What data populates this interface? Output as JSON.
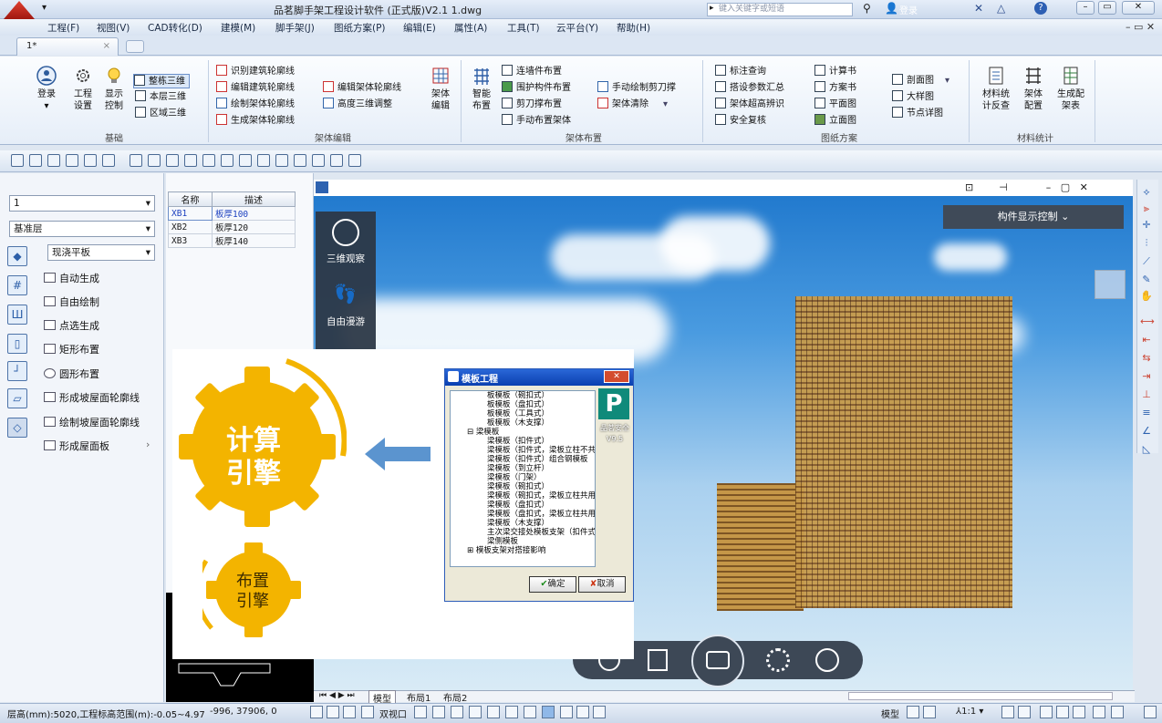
{
  "window": {
    "title": "品茗脚手架工程设计软件 (正式版)V2.1    1.dwg",
    "search_placeholder": "键入关键字或短语",
    "login": "登录",
    "controls": {
      "minimize": "–",
      "restore": "▭",
      "close": "✕"
    }
  },
  "menu": [
    "工程(F)",
    "视图(V)",
    "CAD转化(D)",
    "建模(M)",
    "脚手架(J)",
    "图纸方案(P)",
    "编辑(E)",
    "属性(A)",
    "工具(T)",
    "云平台(Y)",
    "帮助(H)"
  ],
  "doc_tab": {
    "label": "1*",
    "close": "×"
  },
  "ribbon": {
    "groups": [
      {
        "label": "基础"
      },
      {
        "label": "架体编辑"
      },
      {
        "label": "架体布置"
      },
      {
        "label": "图纸方案"
      },
      {
        "label": "材料统计"
      }
    ],
    "basic": {
      "login": "登录",
      "project_settings": [
        "工程",
        "设置"
      ],
      "display_control": [
        "显示",
        "控制"
      ],
      "view_all_3d": "整栋三维",
      "view_floor_3d": "本层三维",
      "view_region_3d": "区域三维"
    },
    "frame_edit": {
      "items": [
        "识别建筑轮廓线",
        "编辑建筑轮廓线",
        "绘制架体轮廓线",
        "生成架体轮廓线"
      ],
      "items2": [
        "编辑架体轮廓线",
        "高度三维调整"
      ],
      "frame_edit_big": [
        "架体",
        "编辑"
      ]
    },
    "frame_layout": {
      "smart_layout": [
        "智能",
        "布置"
      ],
      "items": [
        "连墙件布置",
        "围护构件布置",
        "剪刀撑布置",
        "手动布置架体"
      ],
      "items2": [
        "手动绘制剪刀撑",
        "架体清除"
      ]
    },
    "drawings": {
      "items": [
        "标注查询",
        "搭设参数汇总",
        "架体超高辨识",
        "安全复核"
      ],
      "items2": [
        "计算书",
        "方案书",
        "平面图",
        "立面图"
      ],
      "items3": [
        "剖面图",
        "大样图",
        "节点详图"
      ]
    },
    "materials": {
      "stat_check": [
        "材料统",
        "计反查"
      ],
      "frame_config": [
        "架体",
        "配置"
      ],
      "gen_table": [
        "生成配",
        "架表"
      ]
    }
  },
  "left_panel": {
    "floor_combo": "1",
    "layer_combo": "基准层",
    "type_combo": "现浇平板",
    "tools": [
      "自动生成",
      "自由绘制",
      "点选生成",
      "矩形布置",
      "圆形布置",
      "形成坡屋面轮廓线",
      "绘制坡屋面轮廓线",
      "形成屋面板"
    ]
  },
  "prop_table": {
    "headers": [
      "名称",
      "描述"
    ],
    "rows": [
      [
        "XB1",
        "板厚100"
      ],
      [
        "XB2",
        "板厚120"
      ],
      [
        "XB3",
        "板厚140"
      ]
    ]
  },
  "viewport": {
    "component_control": "构件显示控制",
    "nav": [
      "三维观察",
      "自由漫游"
    ]
  },
  "overlay": {
    "gear_big": [
      "计算",
      "引擎"
    ],
    "gear_small": [
      "布置",
      "引擎"
    ],
    "dialog": {
      "title": "模板工程",
      "logo_caption": [
        "品茗安全",
        "V9.5"
      ],
      "tree": [
        "板模板（碗扣式）",
        "板模板（盘扣式）",
        "板模板（工具式）",
        "板模板（木支撑）",
        "梁模板",
        "梁模板（扣件式）",
        "梁模板（扣件式，梁板立柱不共用）",
        "梁模板（扣件式）组合钢模板",
        "梁模板（到立杆）",
        "梁模板（门架）",
        "梁模板（碗扣式）",
        "梁模板（碗扣式，梁板立柱共用）",
        "梁模板（盘扣式）",
        "梁模板（盘扣式，梁板立柱共用）",
        "梁模板（木支撑）",
        "主次梁交接处模板支架（扣件式）",
        "梁侧模板",
        "模板支架对搭接影响"
      ],
      "ok": "确定",
      "cancel": "取消"
    }
  },
  "layout_tabs": [
    "模型",
    "布局1",
    "布局2"
  ],
  "status": {
    "left": "层高(mm):5020,工程标高范围(m):-0.05~4.97",
    "coords": "-996,  37906,  0",
    "dual_view": "双视口",
    "model": "模型",
    "scale": "1:1"
  }
}
